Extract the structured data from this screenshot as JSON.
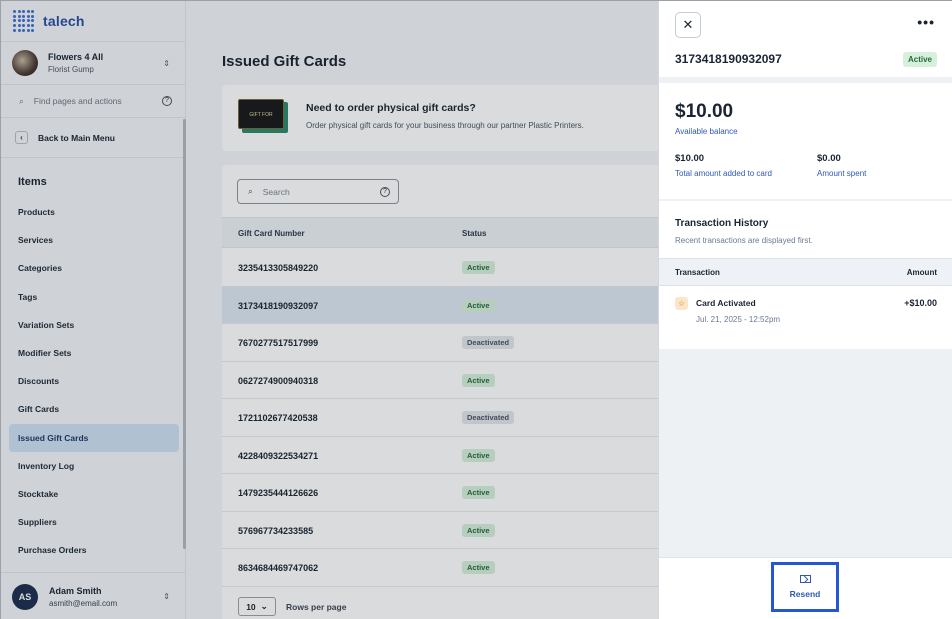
{
  "brand": {
    "name": "talech"
  },
  "store": {
    "name": "Flowers 4 All",
    "subtitle": "Florist Gump"
  },
  "find": {
    "placeholder": "Find pages and actions"
  },
  "back": {
    "label": "Back to Main Menu"
  },
  "nav": {
    "heading": "Items",
    "items": [
      "Products",
      "Services",
      "Categories",
      "Tags",
      "Variation Sets",
      "Modifier Sets",
      "Discounts",
      "Gift Cards",
      "Issued Gift Cards",
      "Inventory Log",
      "Stocktake",
      "Suppliers",
      "Purchase Orders"
    ],
    "active": "Issued Gift Cards"
  },
  "user": {
    "initials": "AS",
    "name": "Adam Smith",
    "email": "asmith@email.com"
  },
  "page": {
    "title": "Issued Gift Cards"
  },
  "promo": {
    "image_text": "GIFT FOR",
    "title": "Need to order physical gift cards?",
    "subtitle": "Order physical gift cards for your business through our partner Plastic Printers."
  },
  "search": {
    "placeholder": "Search"
  },
  "table": {
    "headers": {
      "number": "Gift Card Number",
      "status": "Status"
    },
    "rows": [
      {
        "number": "3235413305849220",
        "status": "Active"
      },
      {
        "number": "3173418190932097",
        "status": "Active"
      },
      {
        "number": "7670277517517999",
        "status": "Deactivated"
      },
      {
        "number": "0627274900940318",
        "status": "Active"
      },
      {
        "number": "1721102677420538",
        "status": "Deactivated"
      },
      {
        "number": "4228409322534271",
        "status": "Active"
      },
      {
        "number": "1479235444126626",
        "status": "Active"
      },
      {
        "number": "576967734233585",
        "status": "Active"
      },
      {
        "number": "8634684469747062",
        "status": "Active"
      }
    ]
  },
  "pager": {
    "rows": "10",
    "label": "Rows per page"
  },
  "panel": {
    "card_number": "3173418190932097",
    "status": "Active",
    "balance": "$10.00",
    "balance_label": "Available balance",
    "added": "$10.00",
    "added_label": "Total amount added to card",
    "spent": "$0.00",
    "spent_label": "Amount spent",
    "history_title": "Transaction History",
    "history_sub": "Recent transactions are displayed first.",
    "col_transaction": "Transaction",
    "col_amount": "Amount",
    "tx_name": "Card Activated",
    "tx_date": "Jul. 21, 2025 - 12:52pm",
    "tx_amount": "+$10.00",
    "resend": "Resend"
  },
  "colors": {
    "accent": "#2557d1",
    "active_badge": "#d7f0dc",
    "deactivated_badge": "#e3e6ea"
  }
}
